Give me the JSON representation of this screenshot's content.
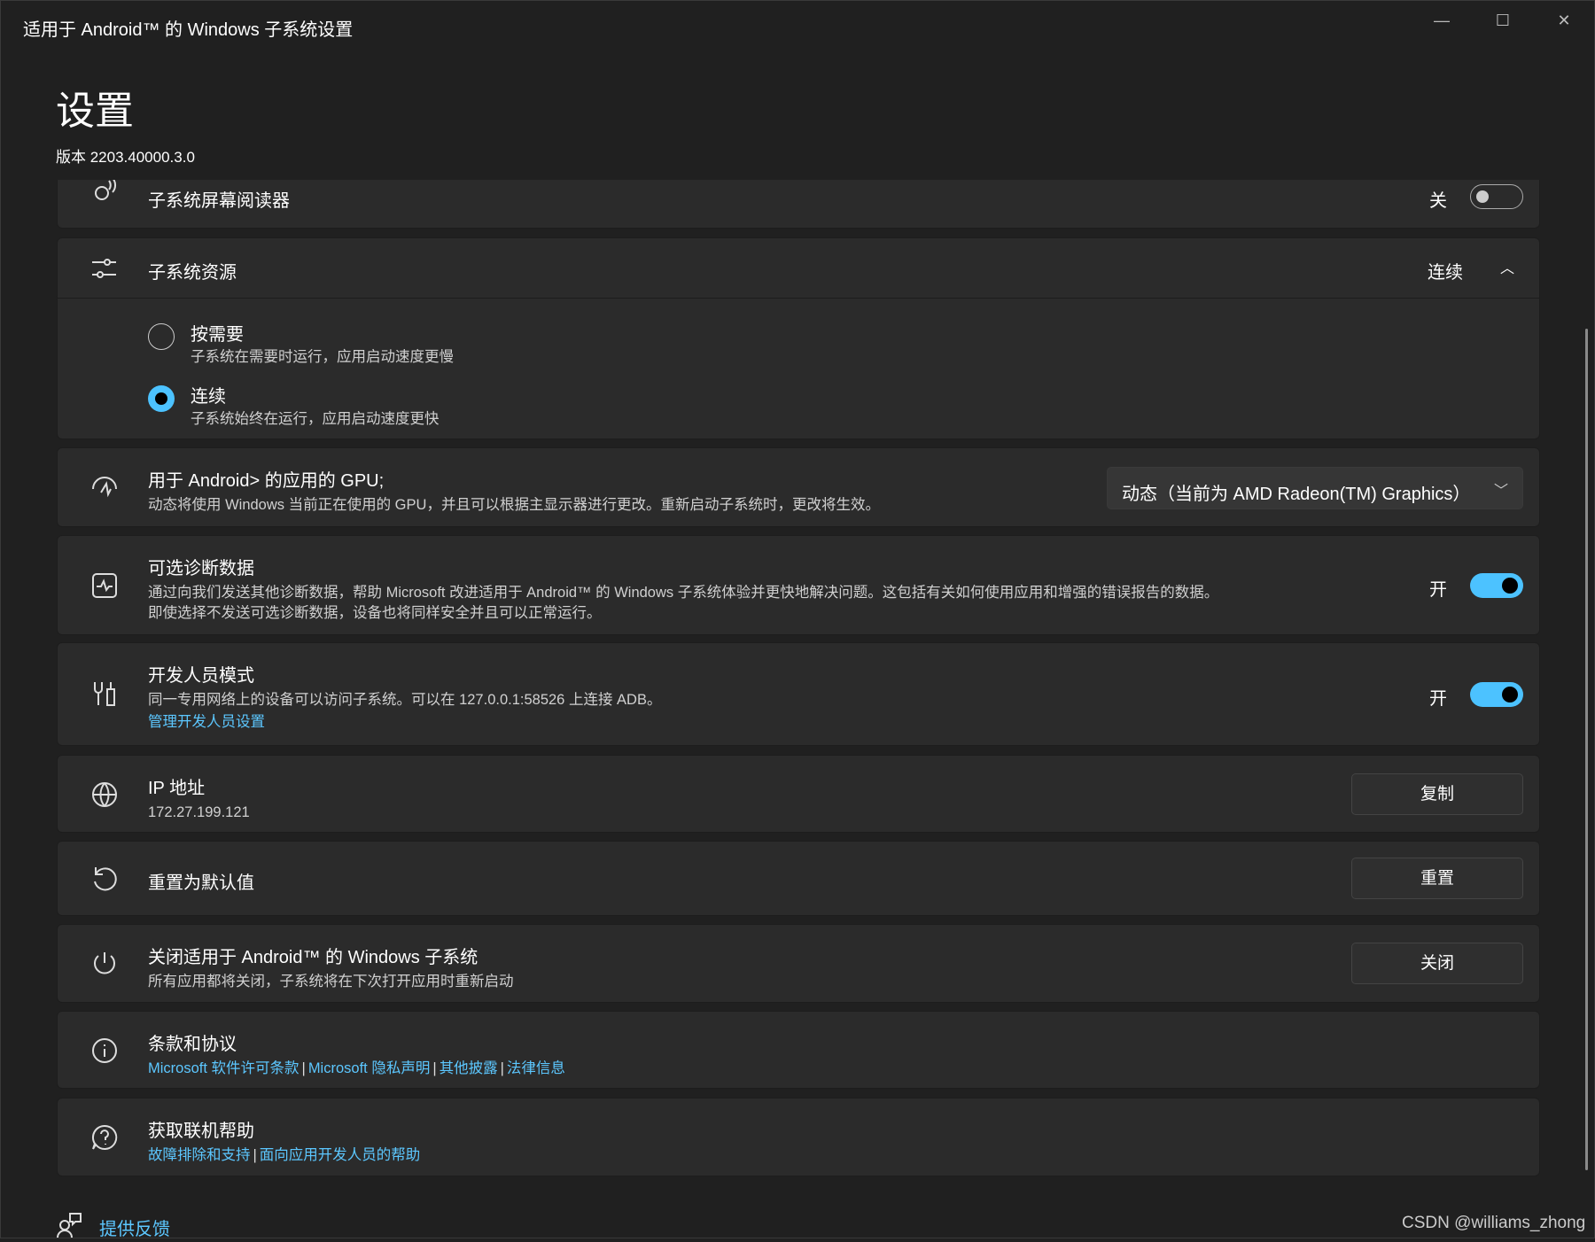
{
  "window": {
    "title": "适用于 Android™ 的 Windows 子系统设置",
    "minimize": "—",
    "maximize": "☐",
    "close": "✕"
  },
  "header": {
    "title": "设置",
    "version": "版本 2203.40000.3.0"
  },
  "screen_reader": {
    "title": "子系统屏幕阅读器",
    "state": "关"
  },
  "resources": {
    "title": "子系统资源",
    "value": "连续",
    "options": [
      {
        "label": "按需要",
        "desc": "子系统在需要时运行，应用启动速度更慢"
      },
      {
        "label": "连续",
        "desc": "子系统始终在运行，应用启动速度更快"
      }
    ]
  },
  "gpu": {
    "title": "用于 Android> 的应用的 GPU;",
    "desc": "动态将使用 Windows 当前正在使用的 GPU，并且可以根据主显示器进行更改。重新启动子系统时，更改将生效。",
    "selected": "动态（当前为 AMD Radeon(TM) Graphics）"
  },
  "diagnostics": {
    "title": "可选诊断数据",
    "desc1": "通过向我们发送其他诊断数据，帮助 Microsoft 改进适用于 Android™ 的 Windows 子系统体验并更快地解决问题。这包括有关如何使用应用和增强的错误报告的数据。",
    "desc2": "即使选择不发送可选诊断数据，设备也将同样安全并且可以正常运行。",
    "state": "开"
  },
  "developer": {
    "title": "开发人员模式",
    "desc": "同一专用网络上的设备可以访问子系统。可以在 127.0.0.1:58526 上连接 ADB。",
    "link": "管理开发人员设置",
    "state": "开"
  },
  "ip": {
    "title": "IP 地址",
    "value": "172.27.199.121",
    "button": "复制"
  },
  "reset": {
    "title": "重置为默认值",
    "button": "重置"
  },
  "shutdown": {
    "title": "关闭适用于 Android™ 的 Windows 子系统",
    "desc": "所有应用都将关闭，子系统将在下次打开应用时重新启动",
    "button": "关闭"
  },
  "terms": {
    "title": "条款和协议",
    "links": [
      "Microsoft 软件许可条款",
      "Microsoft 隐私声明",
      "其他披露",
      "法律信息"
    ],
    "sep": "|"
  },
  "help": {
    "title": "获取联机帮助",
    "links": [
      "故障排除和支持",
      "面向应用开发人员的帮助"
    ],
    "sep": "|"
  },
  "feedback": {
    "label": "提供反馈"
  },
  "watermark": "CSDN @williams_zhong"
}
